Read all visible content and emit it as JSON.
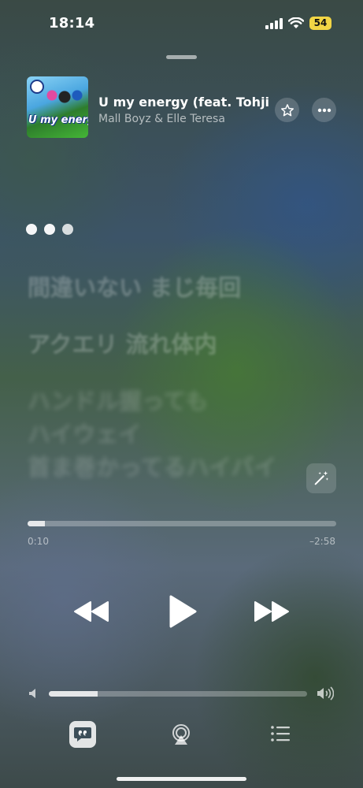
{
  "status_bar": {
    "time": "18:14",
    "battery": "54"
  },
  "track": {
    "title": "U my energy (feat. Tohji &",
    "artist": "Mall Boyz & Elle Teresa",
    "artwork_text": "U my energy"
  },
  "lyrics": {
    "lines": [
      "間違いない まじ毎回",
      "アクエリ 流れ体内",
      "ハンドル握っても",
      "ハイウェイ",
      "首ま巻かってるハイバイ"
    ]
  },
  "playback": {
    "elapsed": "0:10",
    "remaining": "–2:58",
    "progress_fraction": 0.055
  },
  "volume": {
    "level_fraction": 0.19
  },
  "icons": {
    "favorite": "star-icon",
    "more": "ellipsis-icon",
    "transcribe": "magic-wand-icon",
    "rewind": "backward-icon",
    "play": "play-icon",
    "forward": "forward-icon",
    "lyrics": "quote-bubble-icon",
    "airplay": "airplay-icon",
    "queue": "list-icon"
  },
  "colors": {
    "battery": "#f2d545"
  }
}
